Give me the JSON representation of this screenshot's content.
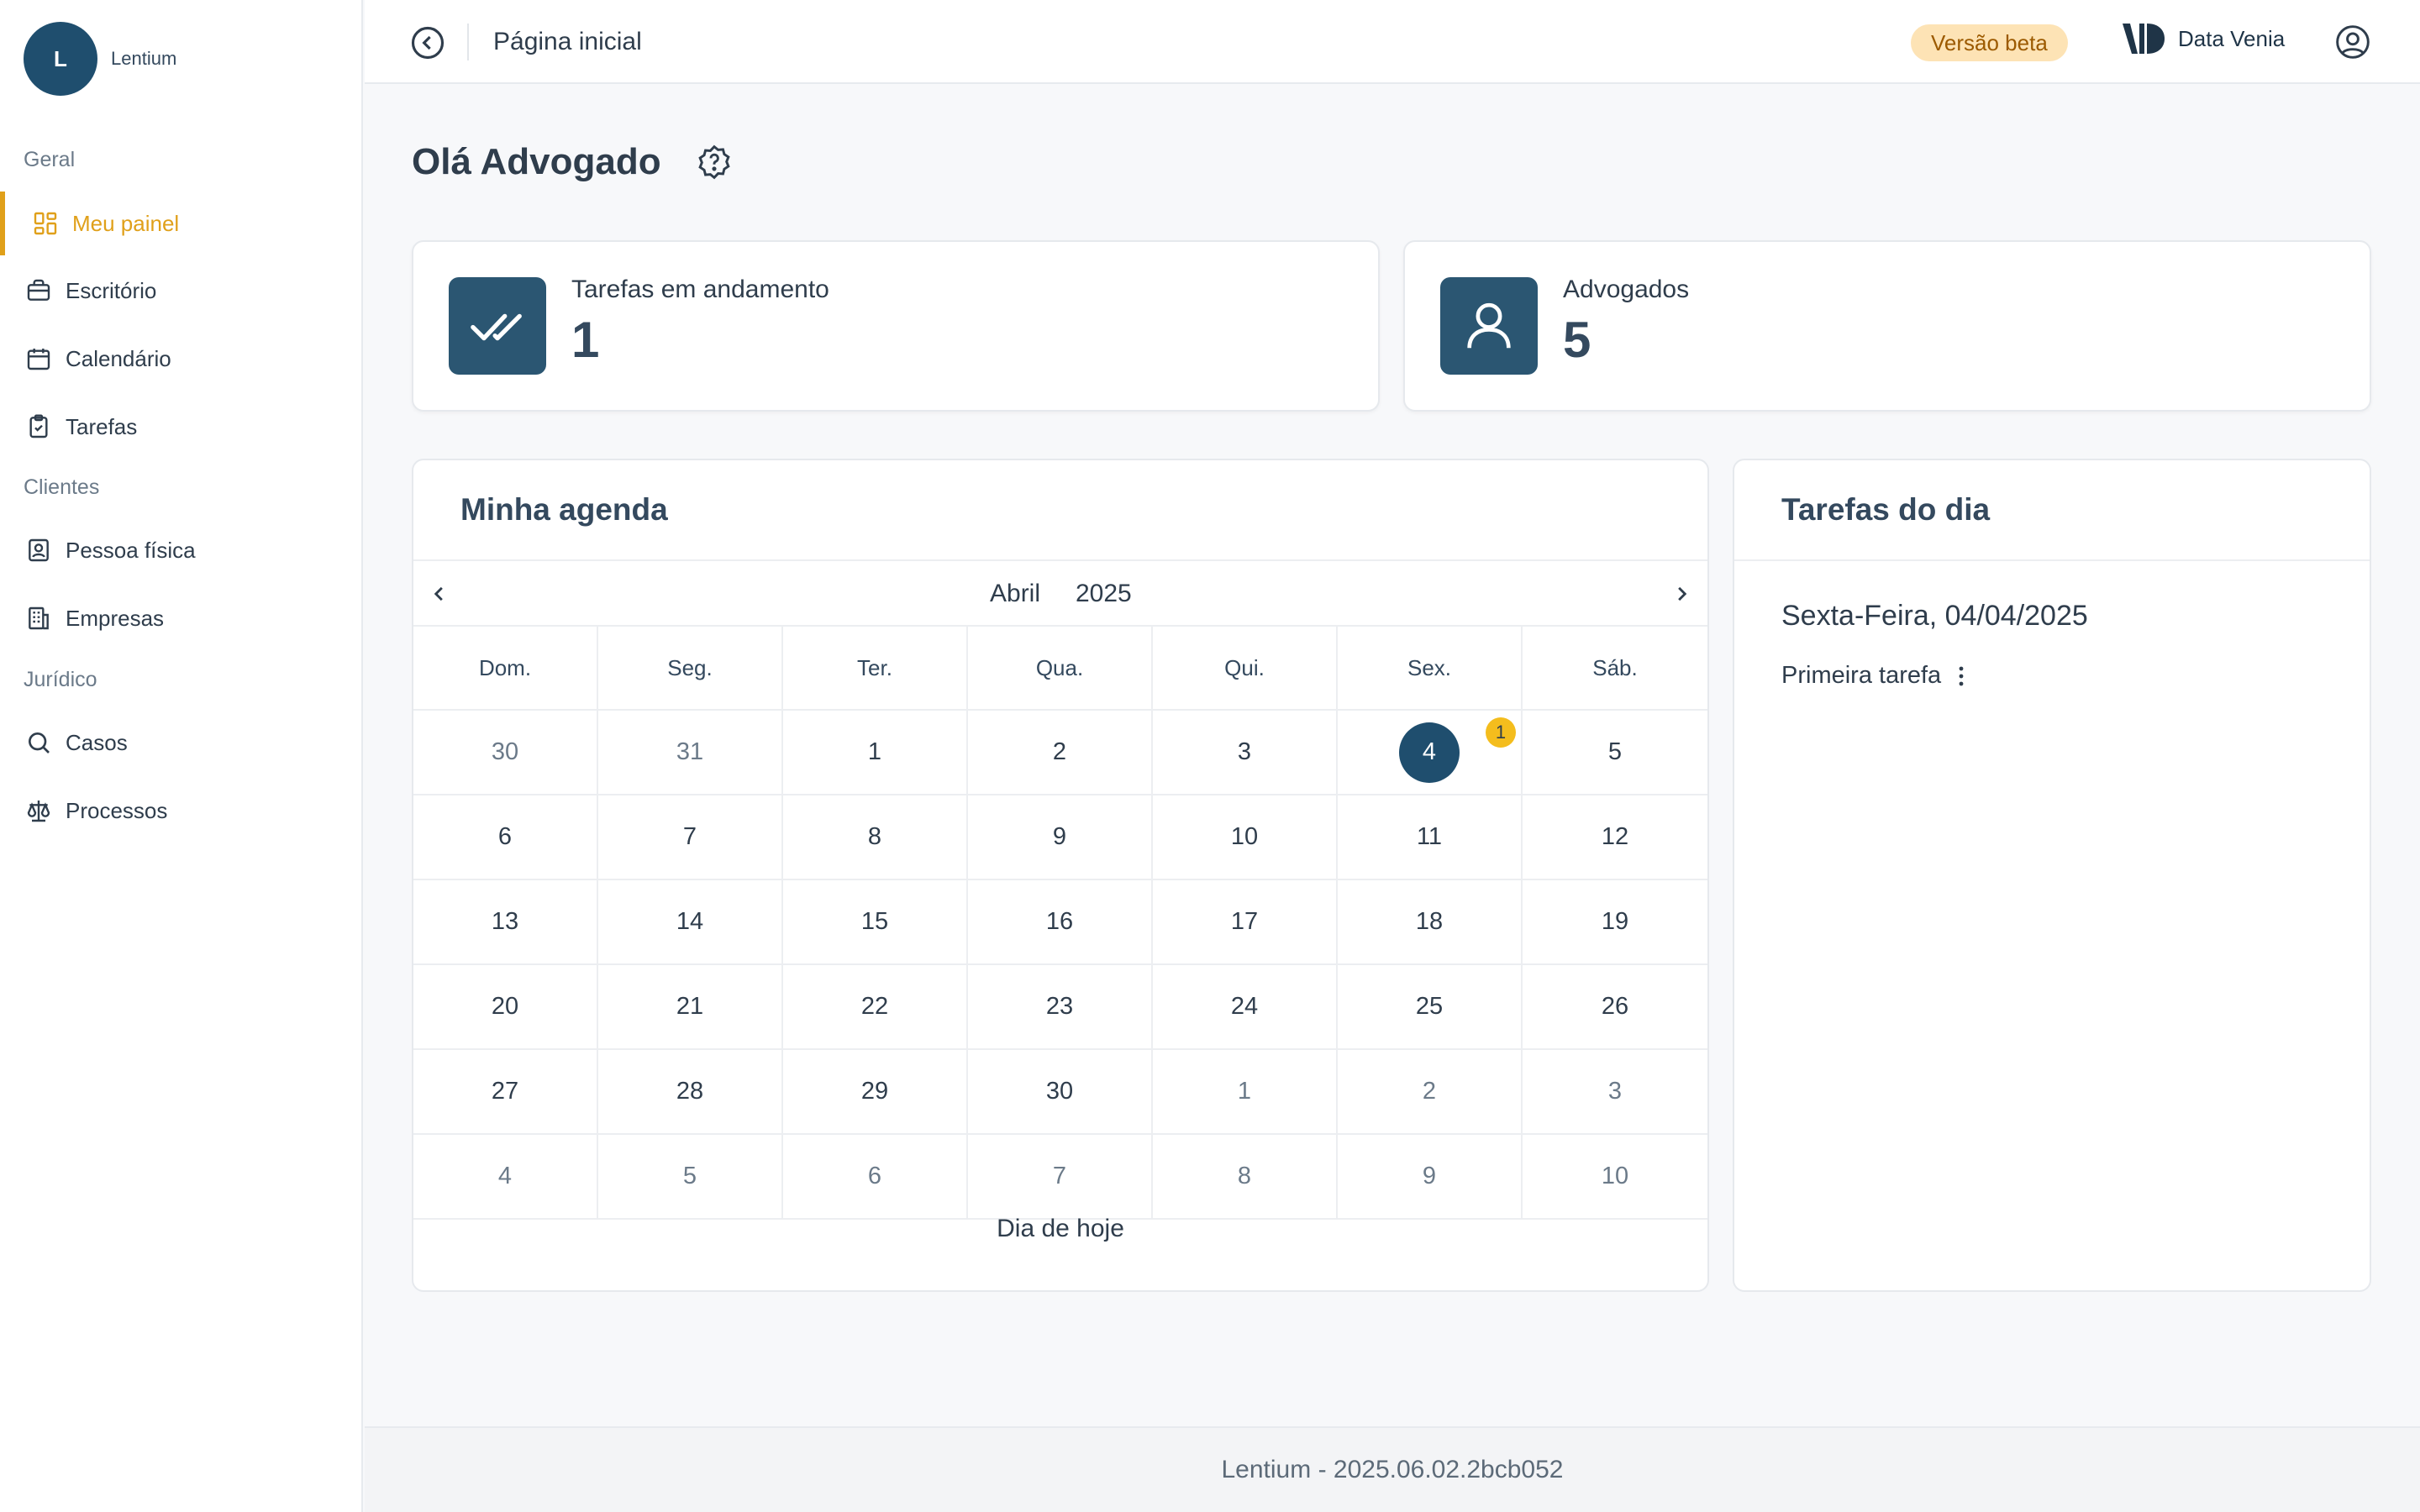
{
  "sidebar": {
    "brand": {
      "initial": "L",
      "name": "Lentium"
    },
    "sections": [
      "Geral",
      "Clientes",
      "Jurídico"
    ],
    "items": [
      {
        "label": "Meu painel",
        "icon": "dashboard-icon",
        "active": true
      },
      {
        "label": "Escritório",
        "icon": "briefcase-icon"
      },
      {
        "label": "Calendário",
        "icon": "calendar-icon"
      },
      {
        "label": "Tarefas",
        "icon": "clipboard-icon"
      },
      {
        "label": "Pessoa física",
        "icon": "id-badge-icon"
      },
      {
        "label": "Empresas",
        "icon": "building-icon"
      },
      {
        "label": "Casos",
        "icon": "search-icon"
      },
      {
        "label": "Processos",
        "icon": "scale-icon"
      }
    ]
  },
  "topbar": {
    "title": "Página inicial",
    "beta_label": "Versão beta",
    "vendor_name": "Data Venia"
  },
  "main": {
    "greeting": "Olá Advogado",
    "stats": [
      {
        "label": "Tarefas em andamento",
        "value": "1",
        "icon": "double-check-icon"
      },
      {
        "label": "Advogados",
        "value": "5",
        "icon": "user-icon"
      }
    ]
  },
  "agenda": {
    "title": "Minha agenda",
    "month": "Abril",
    "year": "2025",
    "weekdays": [
      "Dom.",
      "Seg.",
      "Ter.",
      "Qua.",
      "Qui.",
      "Sex.",
      "Sáb."
    ],
    "weeks": [
      [
        "30",
        "31",
        "1",
        "2",
        "3",
        "4",
        "5"
      ],
      [
        "6",
        "7",
        "8",
        "9",
        "10",
        "11",
        "12"
      ],
      [
        "13",
        "14",
        "15",
        "16",
        "17",
        "18",
        "19"
      ],
      [
        "20",
        "21",
        "22",
        "23",
        "24",
        "25",
        "26"
      ],
      [
        "27",
        "28",
        "29",
        "30",
        "1",
        "2",
        "3"
      ],
      [
        "4",
        "5",
        "6",
        "7",
        "8",
        "9",
        "10"
      ]
    ],
    "selected_badge": "1",
    "today_label": "Dia de hoje"
  },
  "tasks": {
    "title": "Tarefas do dia",
    "date": "Sexta-Feira, 04/04/2025",
    "items": [
      "Primeira tarefa"
    ]
  },
  "footer": {
    "text": "Lentium - 2025.06.02.2bcb052"
  },
  "colors": {
    "primary": "#1f4e6e",
    "accent": "#e0a01a",
    "badge": "#f4bd1d",
    "beta_bg": "#fde3b5"
  }
}
